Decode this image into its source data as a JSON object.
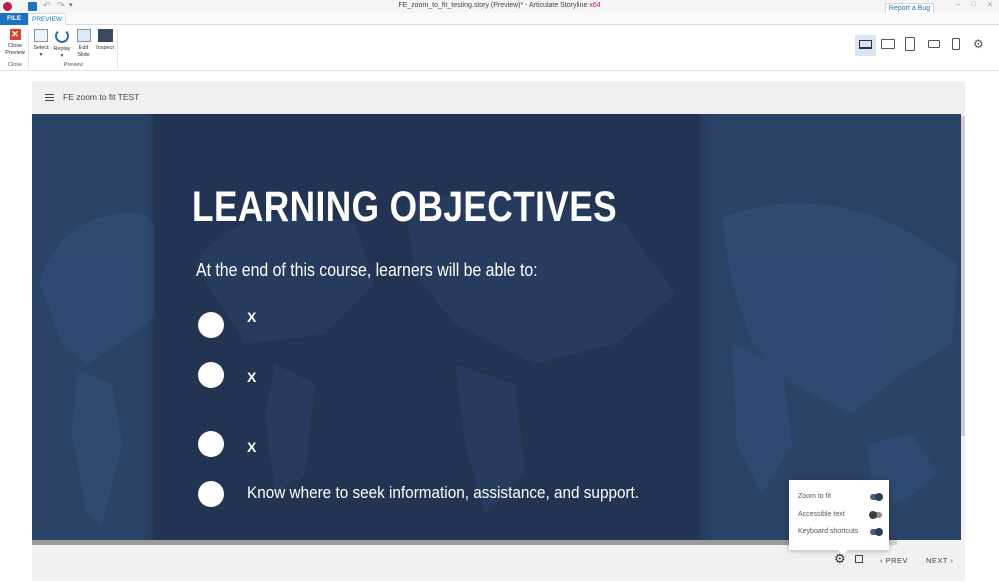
{
  "window": {
    "title_main": "FE_zoom_to_fit_testing.story (Preview)* - Articulate Storyline",
    "title_arch": "x64",
    "report_bug_label": "Report a Bug",
    "controls": {
      "minimize": "–",
      "maximize": "□",
      "close": "✕"
    }
  },
  "quick_access": {
    "undo_glyph": "↶",
    "redo_glyph": "↷",
    "more_glyph": "▾"
  },
  "ribbon": {
    "tabs": [
      {
        "label": "FILE"
      },
      {
        "label": "PREVIEW"
      }
    ],
    "buttons": {
      "close_preview": {
        "label_line1": "Close",
        "label_line2": "Preview",
        "icon_glyph": "✕"
      },
      "select": {
        "label": "Select",
        "dropdown": "▾"
      },
      "replay": {
        "label": "Replay",
        "dropdown": "▾"
      },
      "edit_slide": {
        "label_line1": "Edit",
        "label_line2": "Slide"
      },
      "inspect": {
        "label": "Inspect"
      }
    },
    "groups": {
      "close": "Close",
      "preview": "Preview"
    },
    "devices": [
      "desktop-icon",
      "tablet-landscape-icon",
      "tablet-portrait-icon",
      "phone-landscape-icon",
      "phone-portrait-icon"
    ],
    "settings_glyph": "⚙"
  },
  "player": {
    "course_title": "FE zoom to fit TEST",
    "progress_fraction": 0.93,
    "controls": {
      "settings_glyph": "⚙",
      "prev_label": "‹ PREV",
      "next_label": "NEXT ›"
    },
    "settings_popup": {
      "items": [
        {
          "label": "Zoom to fit",
          "state": "on"
        },
        {
          "label": "Accessible text",
          "state": "off"
        },
        {
          "label": "Keyboard shortcuts",
          "state": "on"
        }
      ]
    }
  },
  "slide": {
    "title": "LEARNING OBJECTIVES",
    "subtitle": "At the end of this course, learners will be able to:",
    "objectives": [
      {
        "text": "X"
      },
      {
        "text": "X"
      },
      {
        "text": "X"
      },
      {
        "text": "Know where to seek information, assistance, and support."
      }
    ]
  },
  "colors": {
    "accent": "#1e73be",
    "slide_background": "#2a4266",
    "slide_panel": "#223451",
    "text_on_slide": "#ffffff"
  }
}
